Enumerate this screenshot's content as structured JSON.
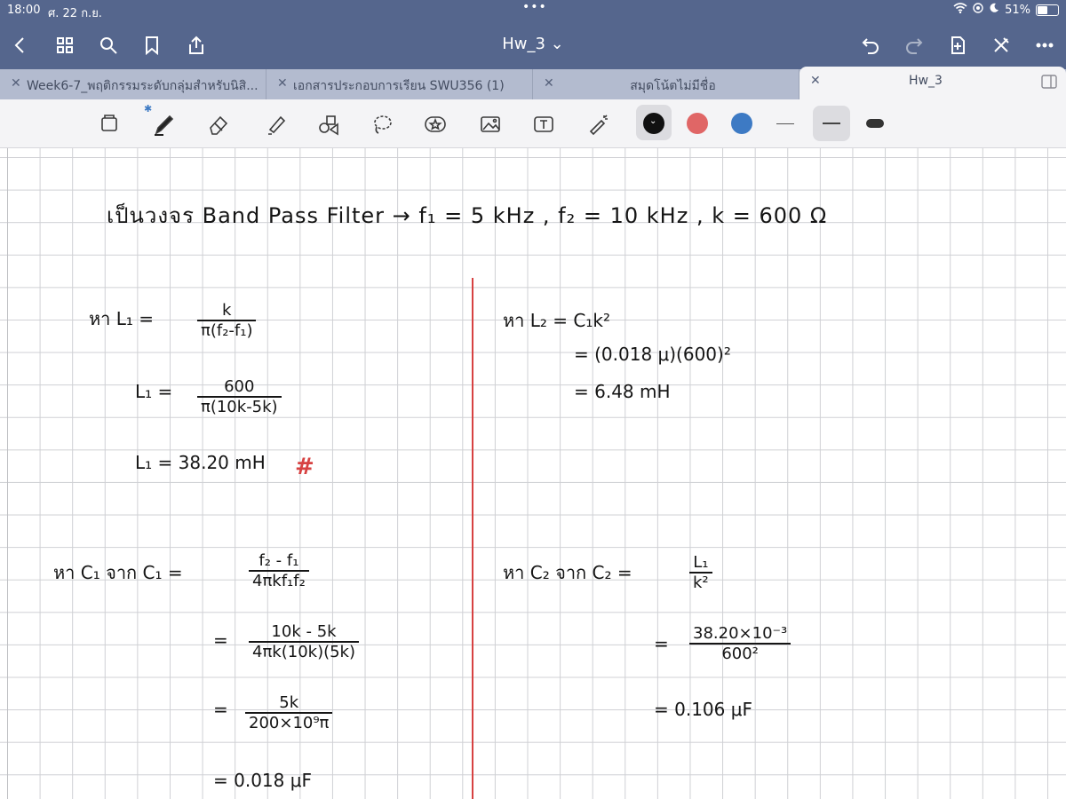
{
  "status": {
    "time": "18:00",
    "date": "ศ. 22 ก.ย.",
    "battery": "51%",
    "battery_level": 0.51
  },
  "header": {
    "title": "Hw_3 ⌄"
  },
  "tabs": [
    {
      "label": "Week6-7_พฤติกรรมระดับกลุ่มสำหรับนิสิ..."
    },
    {
      "label": "เอกสารประกอบการเรียน SWU356 (1)"
    },
    {
      "label": "สมุดโน้ตไม่มีชื่อ"
    },
    {
      "label": "Hw_3",
      "active": true
    }
  ],
  "colors": {
    "accent_bar": "#55668d",
    "tab_bar": "#b3bbcf",
    "pen_black": "#111111",
    "pen_red": "#e06666",
    "pen_blue": "#3d7ac4",
    "margin_red": "#d74242"
  },
  "toolbar_icons": [
    "page-icon",
    "pen-icon",
    "eraser-icon",
    "highlighter-icon",
    "shapes-icon",
    "lasso-icon",
    "sticker-icon",
    "image-icon",
    "text-icon",
    "laser-pointer-icon"
  ],
  "notes": {
    "heading": "เป็นวงจร Band Pass Filter → f₁ = 5 kHz , f₂ = 10 kHz , k = 600 Ω",
    "l1": {
      "prefix": "หา L₁ =",
      "num": "k",
      "den": "π(f₂-f₁)",
      "step2_prefix": "L₁ =",
      "step2_num": "600",
      "step2_den": "π(10k-5k)",
      "result": "L₁ = 38.20 mH",
      "mark": "#"
    },
    "l2": {
      "line1": "หา L₂ = C₁k²",
      "line2": "= (0.018 μ)(600)²",
      "line3": "= 6.48 mH"
    },
    "c1": {
      "prefix": "หา C₁ จาก C₁ =",
      "num1": "f₂ - f₁",
      "den1": "4πkf₁f₂",
      "num2": "10k - 5k",
      "den2": "4πk(10k)(5k)",
      "num3": "5k",
      "den3": "200×10⁹π",
      "result": "= 0.018 μF"
    },
    "c2": {
      "prefix": "หา C₂ จาก C₂ =",
      "num1": "L₁",
      "den1": "k²",
      "num2": "38.20×10⁻³",
      "den2": "600²",
      "result": "= 0.106 μF"
    }
  }
}
